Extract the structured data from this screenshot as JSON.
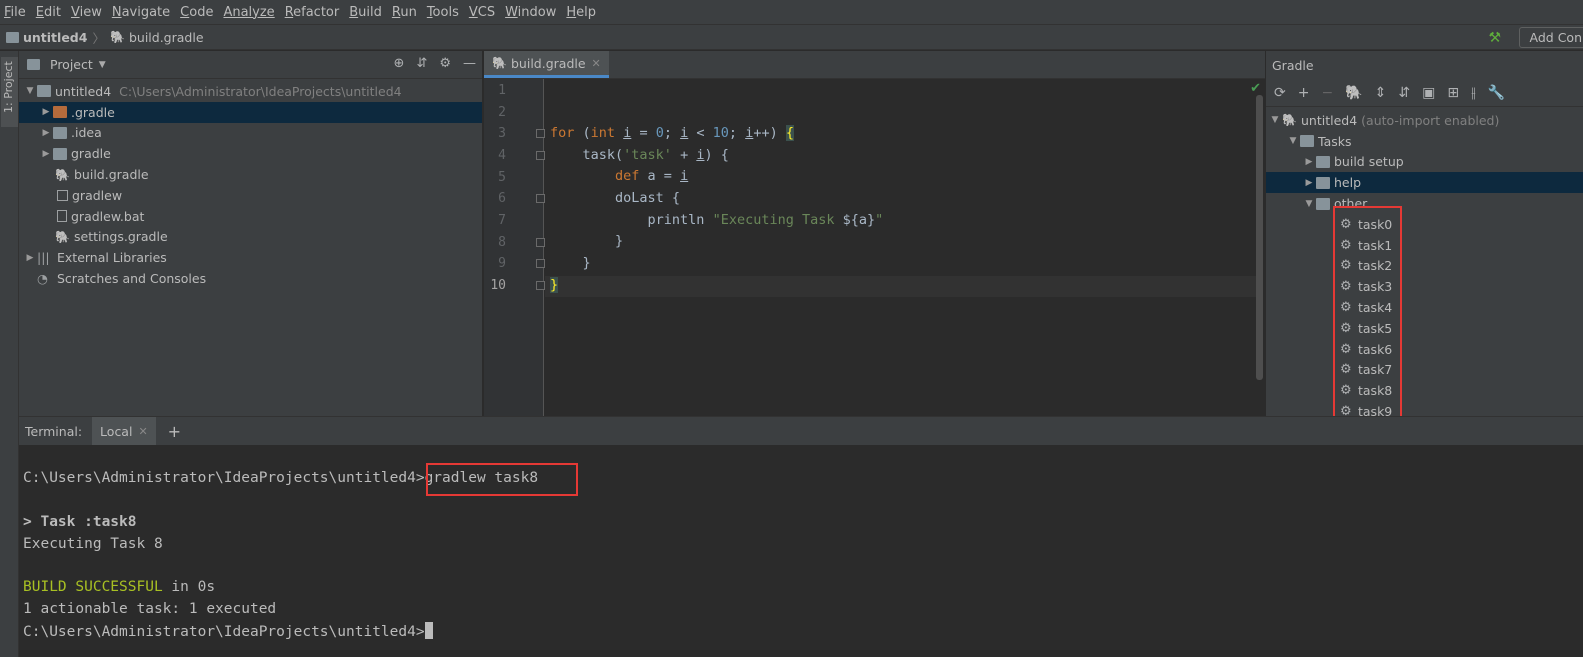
{
  "menu": {
    "items": [
      {
        "u": "F",
        "rest": "ile"
      },
      {
        "u": "E",
        "rest": "dit"
      },
      {
        "u": "V",
        "rest": "iew"
      },
      {
        "u": "N",
        "rest": "avigate"
      },
      {
        "u": "C",
        "rest": "ode"
      },
      {
        "u": "",
        "rest": "Analyze"
      },
      {
        "u": "R",
        "rest": "efactor"
      },
      {
        "u": "B",
        "rest": "uild"
      },
      {
        "u": "R",
        "rest": "un"
      },
      {
        "u": "T",
        "rest": "ools"
      },
      {
        "u": "V",
        "rest": "CS"
      },
      {
        "u": "W",
        "rest": "indow"
      },
      {
        "u": "H",
        "rest": "elp"
      }
    ]
  },
  "breadcrumb": {
    "project": "untitled4",
    "file": "build.gradle"
  },
  "toolbar": {
    "add_config": "Add Con"
  },
  "left_tool": {
    "project_tab": "1: Project"
  },
  "project_panel": {
    "title": "Project",
    "root": {
      "name": "untitled4",
      "path": "C:\\Users\\Administrator\\IdeaProjects\\untitled4"
    },
    "items": [
      ".gradle",
      ".idea",
      "gradle",
      "build.gradle",
      "gradlew",
      "gradlew.bat",
      "settings.gradle"
    ],
    "external": "External Libraries",
    "scratches": "Scratches and Consoles"
  },
  "editor": {
    "tab": "build.gradle",
    "line_numbers": [
      "1",
      "2",
      "3",
      "4",
      "5",
      "6",
      "7",
      "8",
      "9",
      "10"
    ]
  },
  "code": {
    "l3": {
      "for": "for",
      "p1": " (",
      "int": "int",
      "i1": "i",
      "eq": " = ",
      "zero": "0",
      "semi1": "; ",
      "i2": "i",
      "lt": " < ",
      "ten": "10",
      "semi2": "; ",
      "i3": "i",
      "inc": "++) ",
      "open": "{"
    },
    "l4": {
      "a": "    task(",
      "s": "'task'",
      "b": " + ",
      "i": "i",
      "c": ") {"
    },
    "l5": {
      "def": "def",
      "rest": " a = ",
      "i": "i"
    },
    "l6": "        doLast {",
    "l7": {
      "a": "            println ",
      "s": "\"Executing Task ",
      "t": "${a}",
      "q": "\""
    },
    "l8": "        }",
    "l9": "    }",
    "l10": "}"
  },
  "gradle_panel": {
    "title": "Gradle",
    "root": "untitled4",
    "root_note": "(auto-import enabled)",
    "tasks": "Tasks",
    "groups": [
      "build setup",
      "help",
      "other"
    ],
    "task_items": [
      "task0",
      "task1",
      "task2",
      "task3",
      "task4",
      "task5",
      "task6",
      "task7",
      "task8",
      "task9"
    ]
  },
  "terminal": {
    "label": "Terminal:",
    "tab": "Local",
    "prompt": "C:\\Users\\Administrator\\IdeaProjects\\untitled4>",
    "command": "gradlew task8",
    "task_header": "> Task :task8",
    "output1": "Executing Task 8",
    "build_status": "BUILD SUCCESSFUL",
    "build_time": " in 0s",
    "summary": "1 actionable task: 1 executed",
    "prompt2": "C:\\Users\\Administrator\\IdeaProjects\\untitled4>"
  },
  "colors": {
    "highlight": "#e53935",
    "selection": "#0d293e",
    "success": "#a8c023"
  }
}
